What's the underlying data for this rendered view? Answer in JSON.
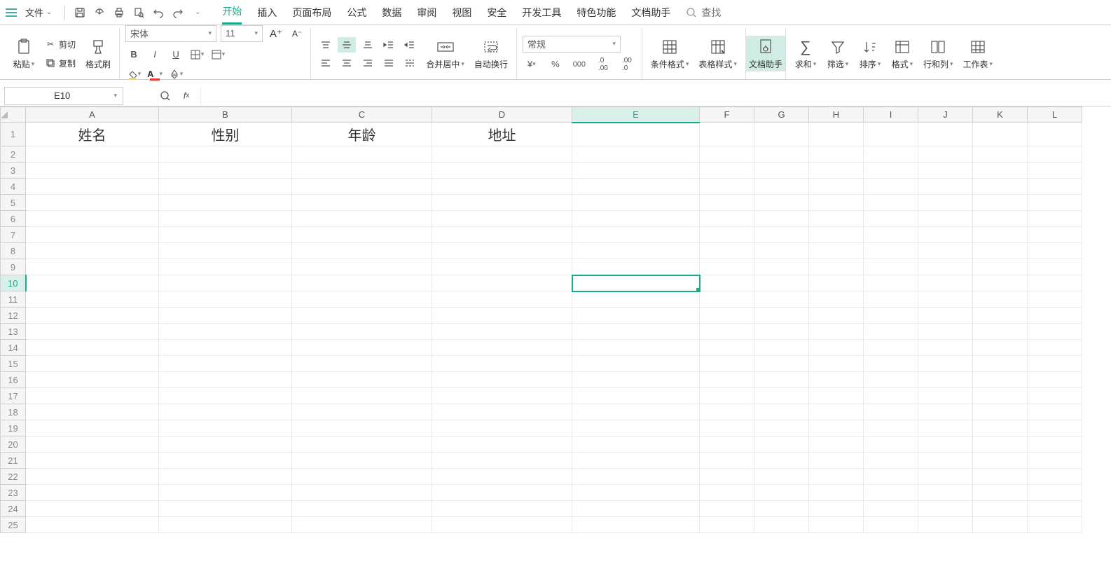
{
  "menubar": {
    "file_label": "文件",
    "search_placeholder": "查找"
  },
  "tabs": [
    "开始",
    "插入",
    "页面布局",
    "公式",
    "数据",
    "审阅",
    "视图",
    "安全",
    "开发工具",
    "特色功能",
    "文档助手"
  ],
  "active_tab": 0,
  "ribbon": {
    "paste": "粘贴",
    "cut": "剪切",
    "copy": "复制",
    "format_painter": "格式刷",
    "font_name": "宋体",
    "font_size": "11",
    "merge_center": "合并居中",
    "wrap_text": "自动换行",
    "number_format": "常规",
    "cond_fmt": "条件格式",
    "table_style": "表格样式",
    "doc_helper": "文档助手",
    "sum": "求和",
    "filter": "筛选",
    "sort": "排序",
    "format": "格式",
    "rowcol": "行和列",
    "worksheet": "工作表"
  },
  "namebox": "E10",
  "formula": "",
  "columns": [
    "A",
    "B",
    "C",
    "D",
    "E",
    "F",
    "G",
    "H",
    "I",
    "J",
    "K",
    "L"
  ],
  "selected_col": "E",
  "selected_row": 10,
  "row_count": 25,
  "cells": {
    "A1": "姓名",
    "B1": "性别",
    "C1": "年龄",
    "D1": "地址"
  }
}
